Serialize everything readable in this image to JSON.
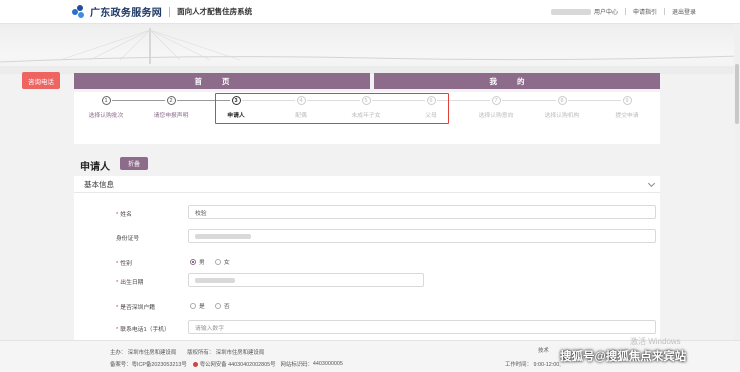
{
  "header": {
    "site_name": "广东政务服务网",
    "subtitle": "面向人才配售住房系统",
    "links": [
      "用户中心",
      "申请指引",
      "退出登录"
    ]
  },
  "side": {
    "hotline": "咨询电话"
  },
  "nav": {
    "home": "首页",
    "mine": "我的"
  },
  "steps": [
    {
      "num": "1",
      "label": "选择认购批次",
      "state": "done"
    },
    {
      "num": "2",
      "label": "请您申报声明",
      "state": "done"
    },
    {
      "num": "3",
      "label": "申请人",
      "state": "active"
    },
    {
      "num": "4",
      "label": "配偶",
      "state": "future"
    },
    {
      "num": "5",
      "label": "未成年子女",
      "state": "future"
    },
    {
      "num": "6",
      "label": "父母",
      "state": "future"
    },
    {
      "num": "7",
      "label": "选择认购意向",
      "state": "future"
    },
    {
      "num": "8",
      "label": "选择认购机构",
      "state": "future"
    },
    {
      "num": "9",
      "label": "提交申请",
      "state": "future"
    }
  ],
  "applicant": {
    "title": "申请人",
    "fold_label": "折叠",
    "section_title": "基本信息",
    "fields": {
      "name": {
        "label": "姓名",
        "value": "校验"
      },
      "id_number": {
        "label": "身份证号"
      },
      "gender": {
        "label": "性别",
        "options": [
          "男",
          "女"
        ],
        "selected": "男"
      },
      "birth": {
        "label": "出生日期"
      },
      "shenzhen_hukou": {
        "label": "是否深圳户籍",
        "options": [
          "是",
          "否"
        ],
        "selected": ""
      },
      "phone": {
        "label": "联系电话1（手机）",
        "placeholder": "请输入数字"
      }
    }
  },
  "footer": {
    "host_label": "主办：",
    "host": "深圳市住房和建设局",
    "rights_label": "版权所有：",
    "rights": "深圳市住房和建设局",
    "icp_label": "备案号：",
    "icp": "粤ICP备2023053213号",
    "police": "粤公网安备 44030402002805号",
    "site_code_label": "网站标识码：",
    "site_code": "4403000005",
    "tech_label": "技术",
    "hours_label": "工作时间：",
    "hours": "9:00-12:00,"
  },
  "overlay": {
    "windows_activation": "激活 Windows",
    "watermark": "搜狐号@搜狐焦点来宾站"
  },
  "colors": {
    "brand": "#8c6b8b",
    "hotline": "#ee6461",
    "highlight": "#e0413b"
  }
}
